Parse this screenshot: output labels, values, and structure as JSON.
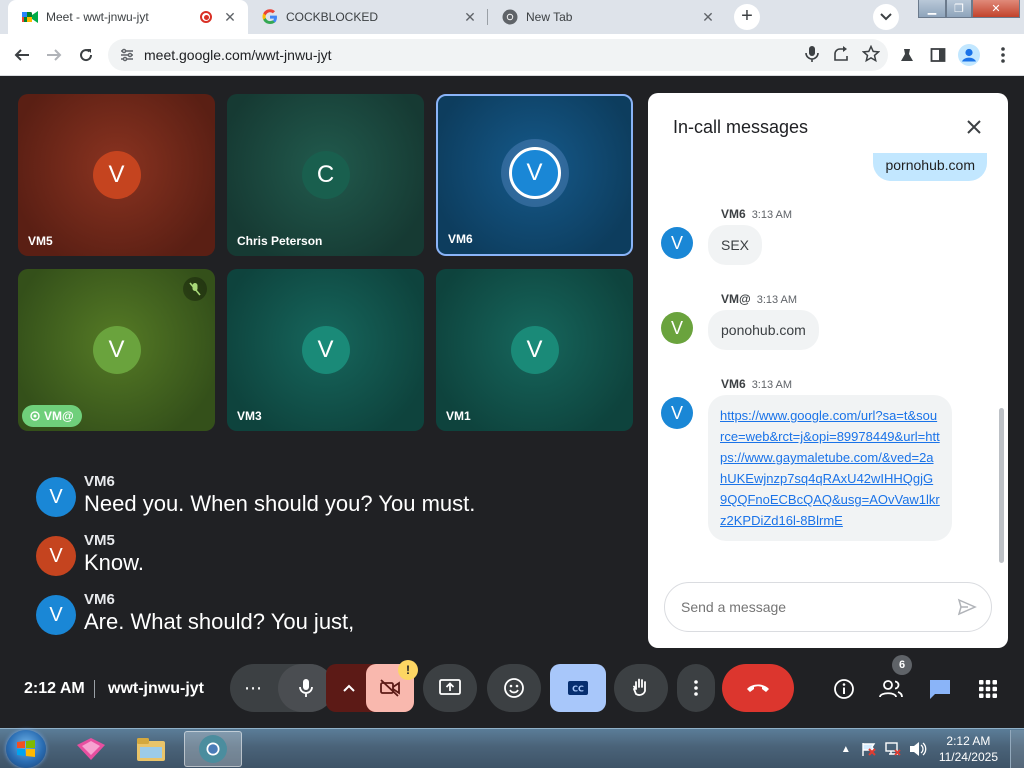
{
  "browser": {
    "tabs": [
      {
        "title": "Meet - wwt-jnwu-jyt",
        "recording": true
      },
      {
        "title": "COCKBLOCKED"
      },
      {
        "title": "New Tab"
      }
    ],
    "url": "meet.google.com/wwt-jnwu-jyt"
  },
  "meet": {
    "tiles": [
      {
        "name": "VM5",
        "initial": "V",
        "bg": "#7a2a1a",
        "avatar_color": "#c5441f"
      },
      {
        "name": "Chris Peterson",
        "initial": "C",
        "bg": "#1d4e43",
        "avatar_color": "#195f4e"
      },
      {
        "name": "VM6",
        "initial": "V",
        "bg": "#0f4d79",
        "avatar_color": "#1a87d6",
        "speaking": true
      },
      {
        "name": "VM@",
        "initial": "V",
        "bg": "#4a6a1f",
        "avatar_color": "#6aa33d",
        "muted": true
      },
      {
        "name": "VM3",
        "initial": "V",
        "bg": "#0f5650",
        "avatar_color": "#1a8a78"
      },
      {
        "name": "VM1",
        "initial": "V",
        "bg": "#0f5650",
        "avatar_color": "#1a8a78"
      }
    ],
    "captions": [
      {
        "speaker": "VM6",
        "initial": "V",
        "color": "#1a87d6",
        "text": "Need you. When should you? You must."
      },
      {
        "speaker": "VM5",
        "initial": "V",
        "color": "#c5441f",
        "text": "Know."
      },
      {
        "speaker": "VM6",
        "initial": "V",
        "color": "#1a87d6",
        "text": "Are. What should? You just,"
      }
    ],
    "time": "2:12 AM",
    "meeting_code": "wwt-jnwu-jyt",
    "people_count": "6",
    "camera_warning": "!"
  },
  "chat": {
    "title": "In-call messages",
    "own_message": "pornohub.com",
    "messages": [
      {
        "sender": "VM6",
        "time": "3:13 AM",
        "initial": "V",
        "color": "#1a87d6",
        "text": "SEX",
        "link": false
      },
      {
        "sender": "VM@",
        "time": "3:13 AM",
        "initial": "V",
        "color": "#6aa33d",
        "text": "ponohub.com",
        "link": false
      },
      {
        "sender": "VM6",
        "time": "3:13 AM",
        "initial": "V",
        "color": "#1a87d6",
        "text": "https://www.google.com/url?sa=t&source=web&rct=j&opi=89978449&url=https://www.gaymaletube.com/&ved=2ahUKEwjnzp7sq4qRAxU42wIHHQgjG9QQFnoECBcQAQ&usg=AOvVaw1lkrz2KPDiZd16l-8BlrmE",
        "link": true
      }
    ],
    "input_placeholder": "Send a message"
  },
  "taskbar": {
    "clock_time": "2:12 AM",
    "clock_date": "11/24/2025"
  }
}
